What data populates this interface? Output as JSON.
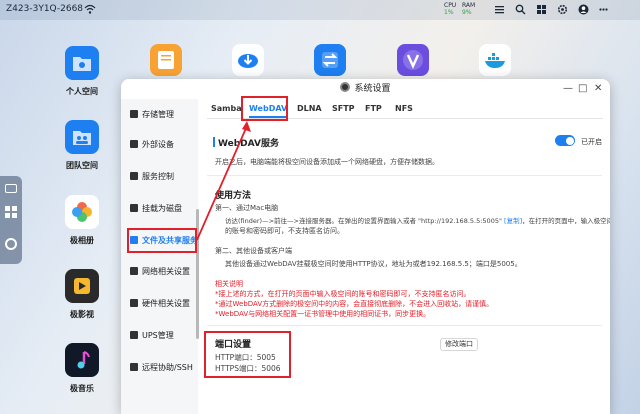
{
  "topbar": {
    "device_name": "Z423-3Y1Q-2668",
    "cpu_label": "CPU",
    "cpu_value": "1%",
    "ram_label": "RAM",
    "ram_value": "9%",
    "icons": [
      "wifi-icon",
      "menu-icon",
      "search-icon",
      "grid-icon",
      "gear-icon",
      "user-icon",
      "more-icon"
    ]
  },
  "desktop": {
    "icons": [
      {
        "label": "个人空间",
        "color": "#1e7ff0"
      },
      {
        "label": "团队空间",
        "color": "#1e7ff0"
      },
      {
        "label": "极相册",
        "color": "#f0604a"
      },
      {
        "label": "极影视",
        "color": "#2a2a2a"
      },
      {
        "label": "极音乐",
        "color": "#111827"
      }
    ],
    "top_row_colors": [
      "#f7a233",
      "#1e7ff0",
      "#1e7ff0",
      "#6b4ee0",
      "#1b9ae0"
    ]
  },
  "window": {
    "title": "系统设置",
    "sidebar": [
      "存储管理",
      "外部设备",
      "服务控制",
      "挂载为磁盘",
      "文件及共享服务",
      "网络相关设置",
      "硬件相关设置",
      "UPS管理",
      "远程协助/SSH"
    ],
    "active_sidebar": "文件及共享服务",
    "tabs": [
      "Samba",
      "WebDAV",
      "DLNA",
      "SFTP",
      "FTP",
      "NFS"
    ],
    "active_tab": "WebDAV",
    "service": {
      "title": "WebDAV服务",
      "toggle_label": "已开启",
      "description": "开启之后，电脑端能将极空间设备添加成一个网络硬盘，方便存储数据。"
    },
    "usage": {
      "title": "使用方法",
      "step1_title": "第一、通过Mac电脑",
      "step1_line1": "访达(finder)—>前往—>连接服务器。在弹出的设置界面输入或者 \"http://192.168.5.5:5005\"",
      "step1_link": "[复制]",
      "step1_line1b": "，在打开的页面中，输入极空间",
      "step1_line2": "的账号和密码即可，不支持匿名访问。",
      "step2_title": "第二、其他设备或客户端",
      "step2_line1": "其他设备通过WebDAV挂载极空间时使用HTTP协议，地址为或者192.168.5.5；端口是5005。"
    },
    "notes": {
      "title": "相关说明",
      "line1": "*接上述的方式，在打开的页面中输入极空间的账号和密码即可，不支持匿名访问。",
      "line2": "*通过WebDAV方式删除的极空间中的内容，会直接彻底删除，不会进入回收站，请谨慎。",
      "line3": "*WebDAV与网络相关配置一证书管理中使用的相同证书，同步更换。"
    },
    "ports": {
      "title": "端口设置",
      "http": "HTTP端口：5005",
      "https": "HTTPS端口：5006",
      "edit_button": "修改端口"
    }
  }
}
